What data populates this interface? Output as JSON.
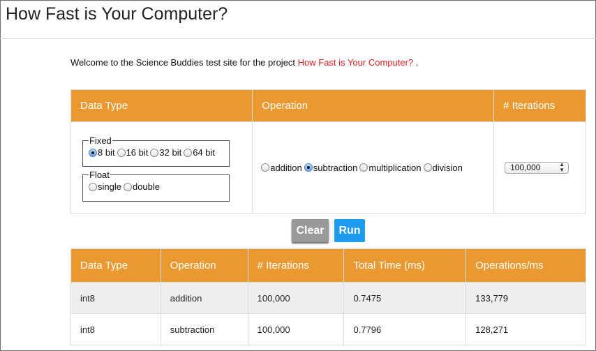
{
  "page": {
    "title": "How Fast is Your Computer?",
    "welcome_prefix": "Welcome to the Science Buddies test site for the project",
    "welcome_link": "How Fast is Your Computer?",
    "welcome_suffix": "."
  },
  "config": {
    "headers": {
      "data_type": "Data Type",
      "operation": "Operation",
      "iterations": "# Iterations"
    },
    "fixed": {
      "legend": "Fixed",
      "options": [
        {
          "label": "8 bit",
          "checked": true
        },
        {
          "label": "16 bit",
          "checked": false
        },
        {
          "label": "32 bit",
          "checked": false
        },
        {
          "label": "64 bit",
          "checked": false
        }
      ]
    },
    "float": {
      "legend": "Float",
      "options": [
        {
          "label": "single",
          "checked": false
        },
        {
          "label": "double",
          "checked": false
        }
      ]
    },
    "operations": [
      {
        "label": "addition",
        "checked": false
      },
      {
        "label": "subtraction",
        "checked": true
      },
      {
        "label": "multiplication",
        "checked": false
      },
      {
        "label": "division",
        "checked": false
      }
    ],
    "iterations_selected": "100,000"
  },
  "buttons": {
    "clear": "Clear",
    "run": "Run"
  },
  "results": {
    "headers": [
      "Data Type",
      "Operation",
      "# Iterations",
      "Total Time (ms)",
      "Operations/ms"
    ],
    "rows": [
      [
        "int8",
        "addition",
        "100,000",
        "0.7475",
        "133,779"
      ],
      [
        "int8",
        "subtraction",
        "100,000",
        "0.7796",
        "128,271"
      ]
    ]
  },
  "colors": {
    "header_orange": "#e9992f",
    "run_blue": "#1d9bf0",
    "clear_gray": "#999999",
    "link_red": "#e41e1e"
  }
}
